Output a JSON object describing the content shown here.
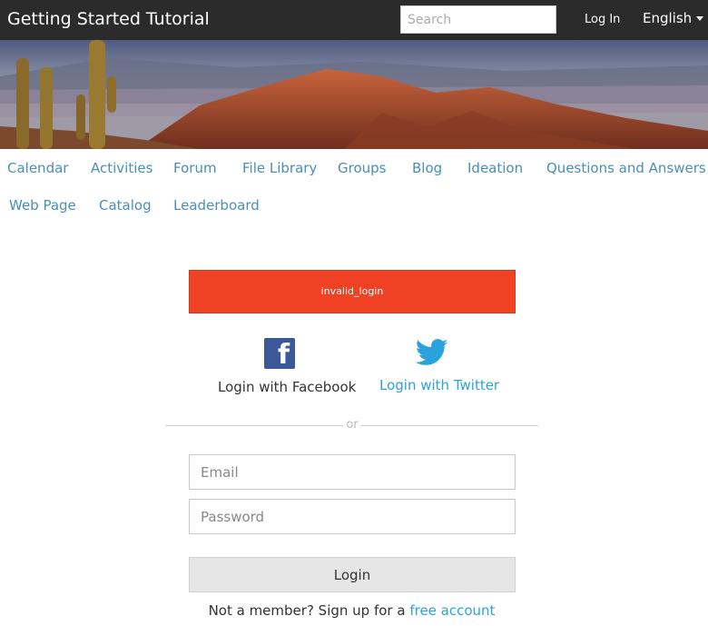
{
  "header": {
    "site_title": "Getting Started Tutorial",
    "search_placeholder": "Search",
    "login_link": "Log In",
    "language": "English"
  },
  "nav": {
    "items": [
      "Calendar",
      "Activities",
      "Forum",
      "File Library",
      "Groups",
      "Blog",
      "Ideation",
      "Questions and Answers",
      "Web Page",
      "Catalog",
      "Leaderboard"
    ]
  },
  "login": {
    "error_message": "invalid_login",
    "facebook_label": "Login with Facebook",
    "twitter_label": "Login with Twitter",
    "separator": "or",
    "email_placeholder": "Email",
    "password_placeholder": "Password",
    "submit_label": "Login",
    "signup_text": "Not a member? Sign up for a",
    "signup_link": "free account"
  },
  "colors": {
    "topbar": "#2b2b2b",
    "link": "#4a8fb5",
    "error": "#f04124",
    "facebook": "#3b5998",
    "twitter": "#2aa3dc"
  },
  "icons": {
    "facebook": "facebook-icon",
    "twitter": "twitter-icon"
  }
}
